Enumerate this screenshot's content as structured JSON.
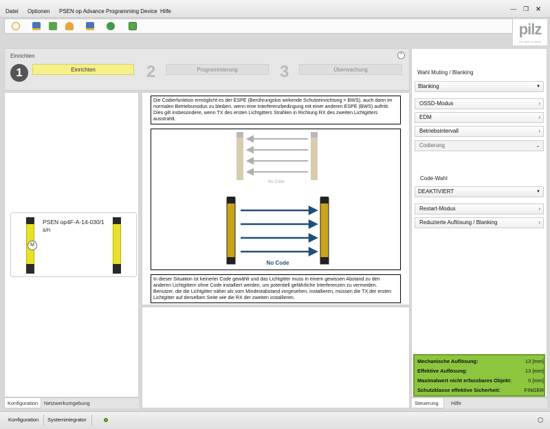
{
  "menu": {
    "items": [
      "Datei",
      "Optionen",
      "PSEN op Advance Programming Device",
      "Hilfe"
    ]
  },
  "window_controls": {
    "minimize": "—",
    "restore": "❐",
    "close": "✕"
  },
  "logo": {
    "text": "pilz",
    "tagline": "the spirit of safety"
  },
  "wizard": {
    "title": "Einrichten",
    "steps": [
      {
        "number": "1",
        "label": "Einrichten"
      },
      {
        "number": "2",
        "label": "Programmierung"
      },
      {
        "number": "3",
        "label": "Überwachung"
      }
    ]
  },
  "device": {
    "name": "PSEN op4F-A-14-030/1 s/n",
    "badge": "M"
  },
  "left_tabs": [
    "Konfiguration",
    "Netzwerkumgebung"
  ],
  "center": {
    "desc_top": "Die Codierfunktion ermöglicht es der ESPE (Berührungslos wirkende Schutzeinrichtung = BWS), auch dann im normalen Betriebsmodus zu bleiben, wenn eine Interferenzbedingung mit einer anderen ESPE (BWS) auftritt. Dies gilt insbesondere, wenn TX des ersten Lichtgitters Strahlen in Richtung RX des zweiten Lichtgitters ausstrahlt.",
    "diagram_label_top": "No Code",
    "diagram_label_bottom": "No Code",
    "desc_bottom": "In dieser Situation ist keinerlei Code gewählt und das Lichtgitter muss in einem gewissen Abstand zu den anderen Lichtgittern ohne Code installiert werden, um potentiell gefährliche Interferenzen zu vermeiden. Benutzer, die die Lichtgitter näher als vom Mindestabstand vorgesehen, installieren, müssen die TX der ersten Lichtgitter auf derselben Seite wie die RX der zweiten installieren."
  },
  "right": {
    "muting_label": "Wahl Muting / Blanking",
    "muting_value": "Blanking",
    "items": [
      "OSSD-Modus",
      "EDM",
      "Betriebsintervall",
      "Codierung"
    ],
    "code_label": "Code-Wahl",
    "code_value": "DEAKTIVIERT",
    "items2": [
      "Restart-Modus",
      "Reduzierte Auflösung / Blanking"
    ],
    "summary": [
      {
        "key": "Mechanische Auflösung:",
        "value": "13 [mm]"
      },
      {
        "key": "Effektive Auflösung:",
        "value": "13 [mm]"
      },
      {
        "key": "Maximalwert nicht erfassbares Objekt:",
        "value": "0 [mm]"
      },
      {
        "key": "Schutzklasse effektive Sicherheit:",
        "value": "FINGER"
      }
    ]
  },
  "right_tabs": [
    "Steuerung",
    "Hilfe"
  ],
  "status": {
    "items": [
      "Konfiguration",
      "Systemintegrator"
    ]
  },
  "colors": {
    "accent_yellow": "#f5f08a",
    "summary_green": "#8cc63f",
    "arrow_blue": "#1f4e79"
  }
}
